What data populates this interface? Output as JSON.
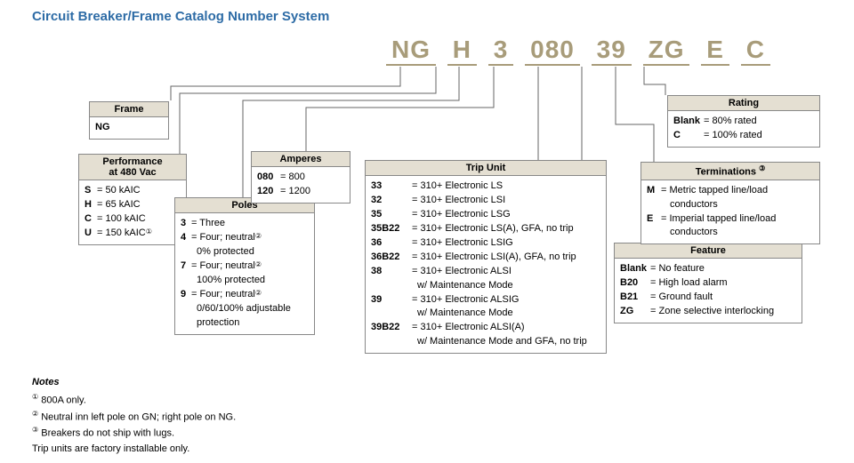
{
  "title": "Circuit Breaker/Frame Catalog Number System",
  "catalog": {
    "seg1": "NG",
    "seg2": "H",
    "seg3": "3",
    "seg4": "080",
    "seg5": "39",
    "seg6": "ZG",
    "seg7": "E",
    "seg8": "C"
  },
  "frame": {
    "head": "Frame",
    "value": "NG"
  },
  "performance": {
    "head": "Performance\nat 480 Vac",
    "rows": [
      {
        "code": "S",
        "text": "= 50 kAIC"
      },
      {
        "code": "H",
        "text": "= 65 kAIC"
      },
      {
        "code": "C",
        "text": "= 100 kAIC"
      },
      {
        "code": "U",
        "text": "= 150 kAIC",
        "sup": "①"
      }
    ]
  },
  "poles": {
    "head": "Poles",
    "rows": [
      {
        "code": "3",
        "text": "= Three"
      },
      {
        "code": "4",
        "text": "= Four; neutral",
        "sup": "②",
        "text2": "0% protected"
      },
      {
        "code": "7",
        "text": "= Four; neutral",
        "sup": "②",
        "text2": "100% protected"
      },
      {
        "code": "9",
        "text": "= Four; neutral",
        "sup": "②",
        "text2": "0/60/100% adjustable protection"
      }
    ]
  },
  "amperes": {
    "head": "Amperes",
    "rows": [
      {
        "code": "080",
        "text": "= 800"
      },
      {
        "code": "120",
        "text": "= 1200"
      }
    ]
  },
  "trip": {
    "head": "Trip Unit",
    "rows": [
      {
        "code": "33",
        "text": "= 310+ Electronic LS"
      },
      {
        "code": "32",
        "text": "= 310+ Electronic LSI"
      },
      {
        "code": "35",
        "text": "= 310+ Electronic LSG"
      },
      {
        "code": "35B22",
        "text": "= 310+ Electronic LS(A), GFA, no trip"
      },
      {
        "code": "36",
        "text": "= 310+ Electronic LSIG"
      },
      {
        "code": "36B22",
        "text": "= 310+ Electronic LSI(A), GFA, no trip"
      },
      {
        "code": "38",
        "text": "= 310+ Electronic ALSI",
        "text2": "w/ Maintenance Mode"
      },
      {
        "code": "39",
        "text": "= 310+ Electronic ALSIG",
        "text2": "w/ Maintenance Mode"
      },
      {
        "code": "39B22",
        "text": "= 310+ Electronic ALSI(A)",
        "text2": "w/ Maintenance Mode and GFA, no trip"
      }
    ]
  },
  "feature": {
    "head": "Feature",
    "rows": [
      {
        "code": "Blank",
        "text": "= No feature"
      },
      {
        "code": "B20",
        "text": "= High load alarm"
      },
      {
        "code": "B21",
        "text": "= Ground fault"
      },
      {
        "code": "ZG",
        "text": "= Zone selective interlocking"
      }
    ]
  },
  "terminations": {
    "head": "Terminations",
    "sup": "③",
    "rows": [
      {
        "code": "M",
        "text": "= Metric tapped line/load",
        "text2": "conductors"
      },
      {
        "code": "E",
        "text": "= Imperial tapped line/load",
        "text2": "conductors"
      }
    ]
  },
  "rating": {
    "head": "Rating",
    "rows": [
      {
        "code": "Blank",
        "text": "= 80% rated"
      },
      {
        "code": "C",
        "text": "= 100% rated"
      }
    ]
  },
  "notes": {
    "head": "Notes",
    "n1": {
      "sup": "①",
      "text": "800A only."
    },
    "n2": {
      "sup": "②",
      "text": "Neutral inn left pole on GN; right pole on NG."
    },
    "n3": {
      "sup": "③",
      "text": "Breakers do not ship with lugs."
    },
    "foot": "Trip units are factory installable only."
  }
}
